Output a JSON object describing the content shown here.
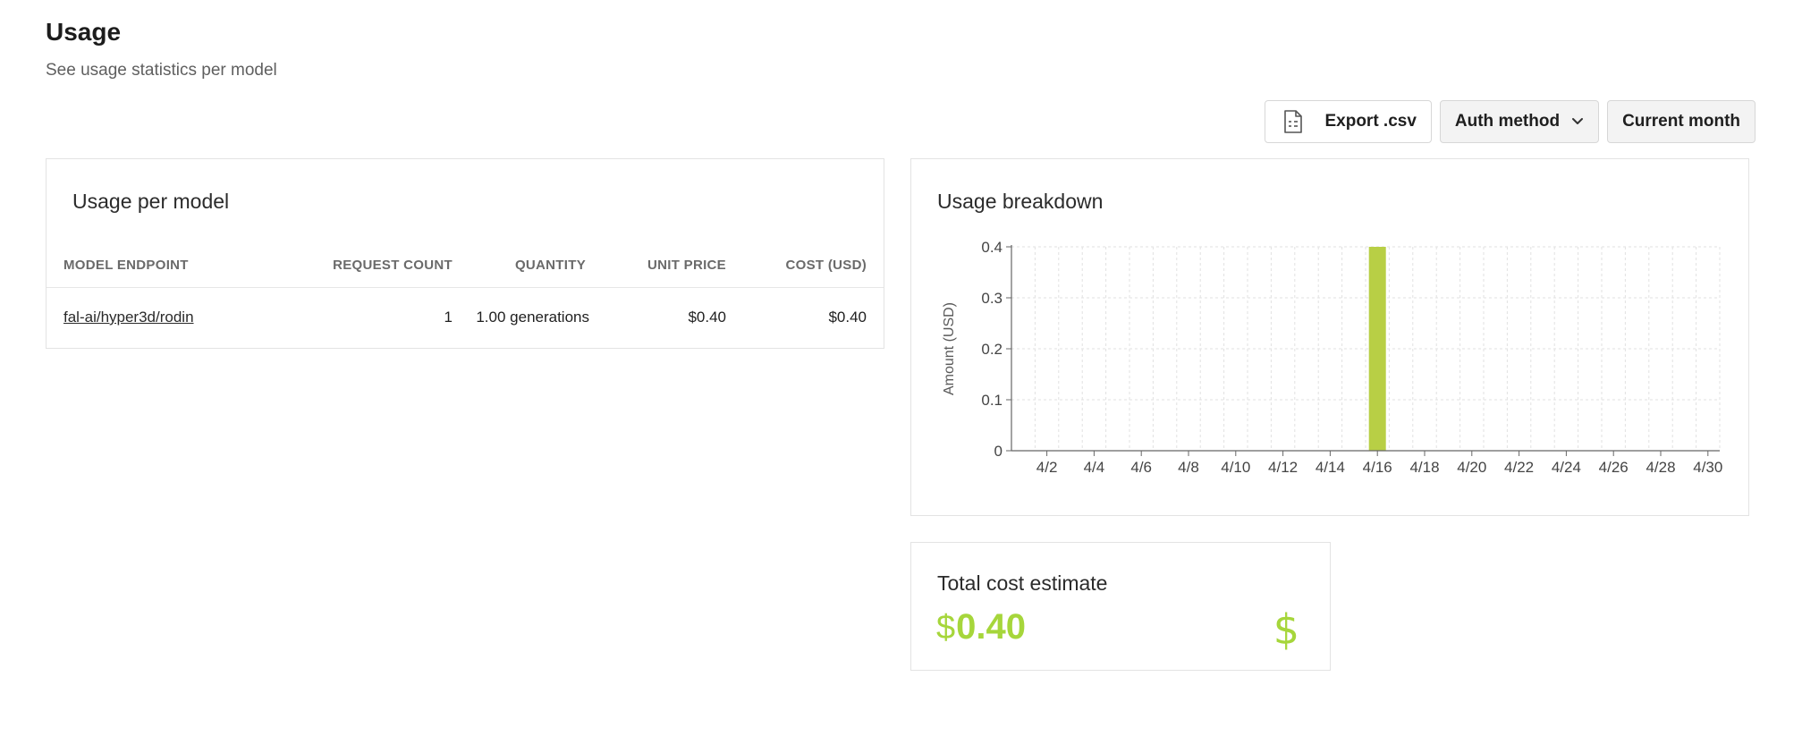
{
  "page": {
    "title": "Usage",
    "subtitle": "See usage statistics per model"
  },
  "toolbar": {
    "export_label": "Export .csv",
    "auth_label": "Auth method",
    "period_label": "Current month"
  },
  "usage_table": {
    "title": "Usage per model",
    "columns": [
      "MODEL ENDPOINT",
      "REQUEST COUNT",
      "QUANTITY",
      "UNIT PRICE",
      "COST (USD)"
    ],
    "rows": [
      {
        "endpoint": "fal-ai/hyper3d/rodin",
        "request_count": "1",
        "quantity": "1.00 generations",
        "unit_price": "$0.40",
        "cost": "$0.40"
      }
    ]
  },
  "breakdown": {
    "title": "Usage breakdown"
  },
  "chart_data": {
    "type": "bar",
    "title": "Usage breakdown",
    "ylabel": "Amount (USD)",
    "xlabel": "",
    "ylim": [
      0,
      0.4
    ],
    "yticks": [
      "0",
      "0.1",
      "0.2",
      "0.3",
      "0.4"
    ],
    "xtick_labels": [
      "4/2",
      "4/4",
      "4/6",
      "4/8",
      "4/10",
      "4/12",
      "4/14",
      "4/16",
      "4/18",
      "4/20",
      "4/22",
      "4/24",
      "4/26",
      "4/28",
      "4/30"
    ],
    "categories": [
      "4/1",
      "4/2",
      "4/3",
      "4/4",
      "4/5",
      "4/6",
      "4/7",
      "4/8",
      "4/9",
      "4/10",
      "4/11",
      "4/12",
      "4/13",
      "4/14",
      "4/15",
      "4/16",
      "4/17",
      "4/18",
      "4/19",
      "4/20",
      "4/21",
      "4/22",
      "4/23",
      "4/24",
      "4/25",
      "4/26",
      "4/27",
      "4/28",
      "4/29",
      "4/30"
    ],
    "values": [
      0,
      0,
      0,
      0,
      0,
      0,
      0,
      0,
      0,
      0,
      0,
      0,
      0,
      0,
      0,
      0.4,
      0,
      0,
      0,
      0,
      0,
      0,
      0,
      0,
      0,
      0,
      0,
      0,
      0,
      0
    ],
    "bar_color": "#b8cf45",
    "grid": true
  },
  "total": {
    "title": "Total cost estimate",
    "currency": "$",
    "amount": "0.40",
    "icon": "dollar-icon",
    "icon_glyph": "$",
    "color": "#a6d63b"
  }
}
